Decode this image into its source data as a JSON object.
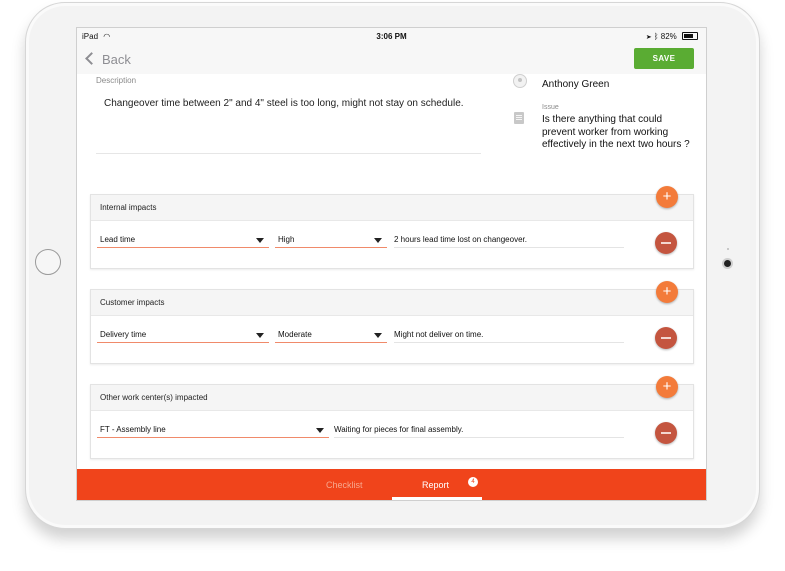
{
  "status_bar": {
    "device": "iPad",
    "time": "3:06 PM",
    "battery": "82%"
  },
  "nav": {
    "back_label": "Back",
    "save_label": "SAVE"
  },
  "description": {
    "label": "Description",
    "text": "Changeover time between 2\" and 4\" steel is too long, might not stay on schedule."
  },
  "reporter": {
    "name": "Anthony Green"
  },
  "issue": {
    "label": "Issue",
    "text": "Is there anything that could prevent worker from working effectively in the next two hours ?"
  },
  "internal_impacts": {
    "title": "Internal impacts",
    "category": "Lead time",
    "severity": "High",
    "comment": "2 hours lead time lost on changeover."
  },
  "customer_impacts": {
    "title": "Customer impacts",
    "category": "Delivery time",
    "severity": "Moderate",
    "comment": "Might not deliver on time."
  },
  "other_work_centers": {
    "title": "Other work center(s) impacted",
    "work_center": "FT - Assembly line",
    "comment": "Waiting for pieces for final assembly."
  },
  "tabs": {
    "checklist": "Checklist",
    "report": "Report",
    "report_badge": "4"
  },
  "colors": {
    "accent": "#f0441b",
    "save": "#5aac33",
    "add": "#f37b3a",
    "remove": "#c4553f"
  }
}
